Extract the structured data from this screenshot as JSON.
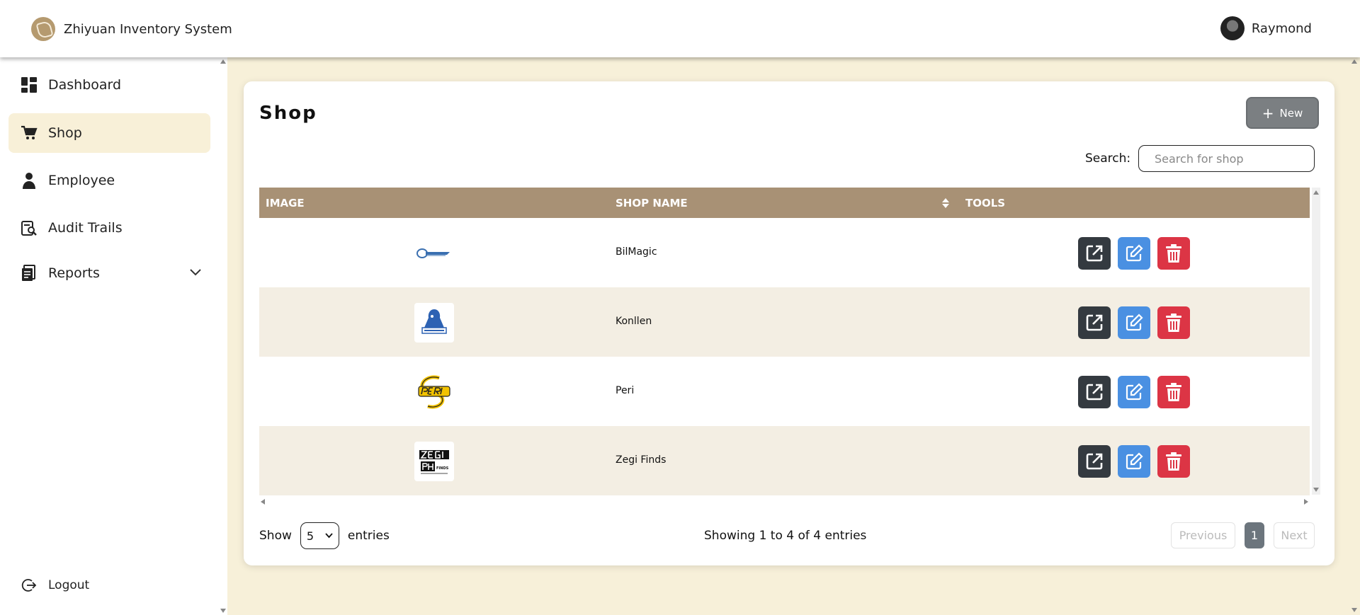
{
  "header": {
    "app_title": "Zhiyuan Inventory System",
    "user_name": "Raymond",
    "logo_icon": "app-logo-icon",
    "avatar_icon": "user-avatar"
  },
  "sidebar": {
    "items": [
      {
        "label": "Dashboard",
        "icon": "dashboard-icon",
        "active": false
      },
      {
        "label": "Shop",
        "icon": "cart-icon",
        "active": true
      },
      {
        "label": "Employee",
        "icon": "person-icon",
        "active": false
      },
      {
        "label": "Audit Trails",
        "icon": "audit-search-icon",
        "active": false
      },
      {
        "label": "Reports",
        "icon": "report-icon",
        "active": false,
        "expandable": true
      }
    ],
    "logout_label": "Logout"
  },
  "main": {
    "title": "Shop",
    "new_button_label": "New",
    "search_label": "Search:",
    "search_placeholder": "Search for shop",
    "search_value": "",
    "table": {
      "columns": [
        "IMAGE",
        "SHOP NAME",
        "TOOLS"
      ],
      "rows": [
        {
          "image": "bilmagic-logo",
          "name": "BilMagic"
        },
        {
          "image": "konllen-logo",
          "name": "Konllen"
        },
        {
          "image": "peri-logo",
          "name": "Peri"
        },
        {
          "image": "zegi-finds-logo",
          "name": "Zegi Finds"
        }
      ]
    },
    "show_label": "Show",
    "page_size": "5",
    "entries_label": "entries",
    "info": "Showing 1 to 4 of 4 entries",
    "pagination": {
      "previous": "Previous",
      "current": "1",
      "next": "Next"
    }
  },
  "colors": {
    "page_bg": "#f7f0d9",
    "table_header": "#a89175",
    "active_nav": "#f8f0d8",
    "row_alt": "#f3eee3",
    "btn_open": "#343a40",
    "btn_edit": "#4a90e2",
    "btn_delete": "#dc3545",
    "btn_new": "#7b7f82"
  }
}
